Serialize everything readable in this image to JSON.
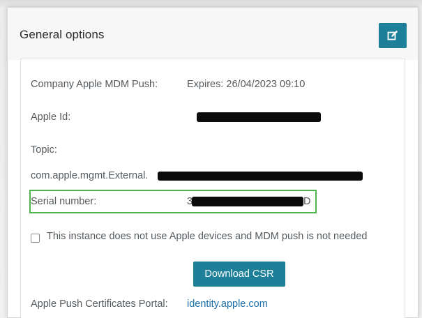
{
  "panel": {
    "title": "General options",
    "edit_icon": "edit-icon"
  },
  "fields": {
    "company_push_label": "Company Apple MDM Push:",
    "company_push_value": "Expires: 26/04/2023 09:10",
    "apple_id_label": "Apple Id:",
    "topic_label": "Topic:",
    "topic_value_prefix": "com.apple.mgmt.External.",
    "serial_label": "Serial number:",
    "serial_value_first": "3",
    "serial_value_last": "D"
  },
  "checkbox": {
    "label": "This instance does not use Apple devices and MDM push is not needed",
    "checked": false
  },
  "buttons": {
    "download_csr": "Download CSR"
  },
  "portal": {
    "label": "Apple Push Certificates Portal:",
    "link_text": "identity.apple.com"
  },
  "colors": {
    "accent": "#1d7f98",
    "highlight_border": "#4fb34f",
    "link": "#1e6fa8"
  }
}
